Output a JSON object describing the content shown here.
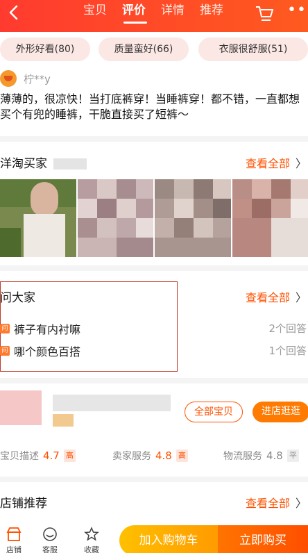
{
  "header": {
    "tabs": [
      {
        "label": "宝贝",
        "active": false
      },
      {
        "label": "评价",
        "active": true
      },
      {
        "label": "详情",
        "active": false
      },
      {
        "label": "推荐",
        "active": false
      }
    ],
    "more_label": "•••"
  },
  "tags": [
    "外形好看(80)",
    "质量蛮好(66)",
    "衣服很舒服(51)"
  ],
  "review": {
    "reviewer": "柠**y",
    "text": "薄薄的，很凉快！当打底裤穿！当睡裤穿！都不错，一直都想买个有兜的睡裤，干脆直接买了短裤～"
  },
  "buyer_show": {
    "title": "洋淘买家",
    "see_all": "查看全部",
    "chevron": "〉"
  },
  "qa": {
    "title": "问大家",
    "see_all": "查看全部",
    "chevron": "〉",
    "badge": "问",
    "items": [
      {
        "question": "裤子有内衬嘛",
        "answers": "2个回答"
      },
      {
        "question": "哪个颜色百搭",
        "answers": "1个回答"
      }
    ]
  },
  "store": {
    "all_items": "全部宝贝",
    "visit": "进店逛逛",
    "ratings": [
      {
        "label": "宝贝描述",
        "value": "4.7",
        "level": "高"
      },
      {
        "label": "卖家服务",
        "value": "4.8",
        "level": "高"
      },
      {
        "label": "物流服务",
        "value": "4.8",
        "level": "平"
      }
    ]
  },
  "shop_recommend": {
    "title": "店铺推荐",
    "see_all": "查看全部",
    "chevron": "〉"
  },
  "bottom": {
    "store_label": "店铺",
    "service_label": "客服",
    "favorite_label": "收藏",
    "add_cart": "加入购物车",
    "buy_now": "立即购买"
  },
  "colors": {
    "accent": "#ff5000",
    "header": "#ff3b2f",
    "cart_button": "#ffa200",
    "buy_button": "#ff5a00"
  }
}
